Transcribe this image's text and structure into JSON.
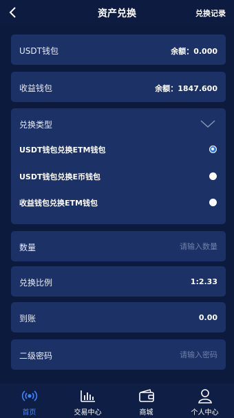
{
  "header": {
    "title": "资产兑换",
    "records_link": "兑换记录"
  },
  "wallets": [
    {
      "name": "USDT钱包",
      "balance_label": "余额：",
      "balance": "0.000"
    },
    {
      "name": "收益钱包",
      "balance_label": "余额：",
      "balance": "1847.600"
    }
  ],
  "exchange_type": {
    "label": "兑换类型",
    "options": [
      {
        "label": "USDT钱包兑换ETM钱包",
        "selected": true
      },
      {
        "label": "USDT钱包兑换E币钱包",
        "selected": false
      },
      {
        "label": "收益钱包兑换ETM钱包",
        "selected": false
      }
    ]
  },
  "form": {
    "quantity_label": "数量",
    "quantity_placeholder": "请输入数量",
    "ratio_label": "兑换比例",
    "ratio_value": "1:2.33",
    "arrival_label": "到账",
    "arrival_value": "0.00",
    "password_label": "二级密码",
    "password_placeholder": "请输入密码"
  },
  "tabbar": {
    "tabs": [
      {
        "label": "首页",
        "icon": "home-icon",
        "active": true
      },
      {
        "label": "交易中心",
        "icon": "chart-icon",
        "active": false
      },
      {
        "label": "商城",
        "icon": "wallet-icon",
        "active": false
      },
      {
        "label": "个人中心",
        "icon": "person-icon",
        "active": false
      }
    ]
  },
  "colors": {
    "background": "#0c1a3e",
    "card": "#1c3166",
    "accent": "#2e7bf0",
    "active_tab": "#3a86ff"
  }
}
